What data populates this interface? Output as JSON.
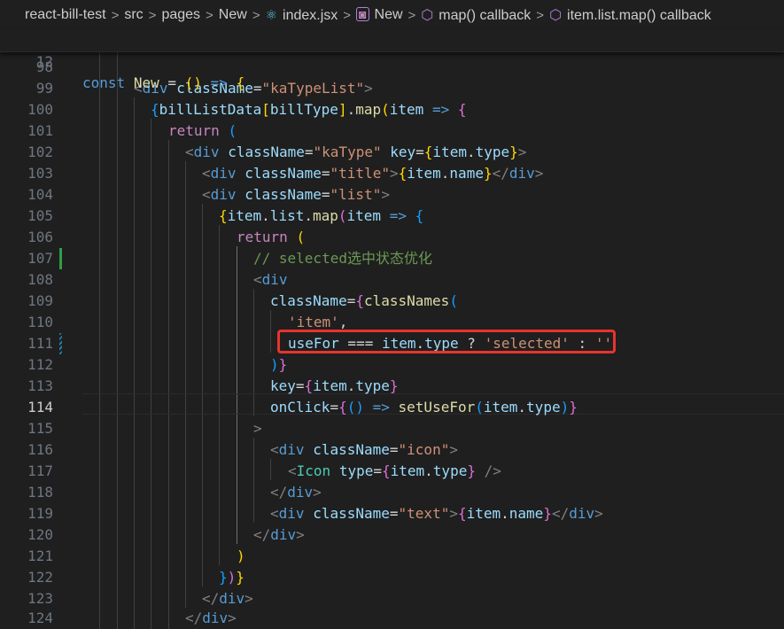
{
  "breadcrumb": {
    "items": [
      "react-bill-test",
      "src",
      "pages",
      "New",
      "index.jsx",
      "New",
      "map() callback",
      "item.list.map() callback"
    ],
    "separator": ">",
    "icons": [
      "react-icon",
      "symbol-variable-icon",
      "symbol-method-icon",
      "symbol-method-icon"
    ]
  },
  "sticky_line": {
    "number": "12",
    "text": "const New = () => {"
  },
  "editor": {
    "active_line": "114",
    "lines": [
      {
        "n": "98",
        "text": ""
      },
      {
        "n": "99",
        "text": "<div className=\"kaTypeList\">"
      },
      {
        "n": "100",
        "text": "{billListData[billType].map(item => {"
      },
      {
        "n": "101",
        "text": "return ("
      },
      {
        "n": "102",
        "text": "<div className=\"kaType\" key={item.type}>"
      },
      {
        "n": "103",
        "text": "<div className=\"title\">{item.name}</div>"
      },
      {
        "n": "104",
        "text": "<div className=\"list\">"
      },
      {
        "n": "105",
        "text": "{item.list.map(item => {"
      },
      {
        "n": "106",
        "text": "return ("
      },
      {
        "n": "107",
        "text": "// selected选中状态优化"
      },
      {
        "n": "108",
        "text": "<div"
      },
      {
        "n": "109",
        "text": "className={classNames("
      },
      {
        "n": "110",
        "text": "'item',"
      },
      {
        "n": "111",
        "text": "useFor === item.type ? 'selected' : ''"
      },
      {
        "n": "112",
        "text": ")}"
      },
      {
        "n": "113",
        "text": "key={item.type}"
      },
      {
        "n": "114",
        "text": "onClick={() => setUseFor(item.type)}"
      },
      {
        "n": "115",
        "text": ">"
      },
      {
        "n": "116",
        "text": "<div className=\"icon\">"
      },
      {
        "n": "117",
        "text": "<Icon type={item.type} />"
      },
      {
        "n": "118",
        "text": "</div>"
      },
      {
        "n": "119",
        "text": "<div className=\"text\">{item.name}</div>"
      },
      {
        "n": "120",
        "text": "</div>"
      },
      {
        "n": "121",
        "text": ")"
      },
      {
        "n": "122",
        "text": "})}"
      },
      {
        "n": "123",
        "text": "</div>"
      },
      {
        "n": "124",
        "text": "</div>"
      }
    ]
  },
  "colors": {
    "background": "#1f1f1f",
    "highlight_box": "#e8332d",
    "gutter_added": "#2ea043",
    "gutter_modified": "#1b81a8"
  }
}
